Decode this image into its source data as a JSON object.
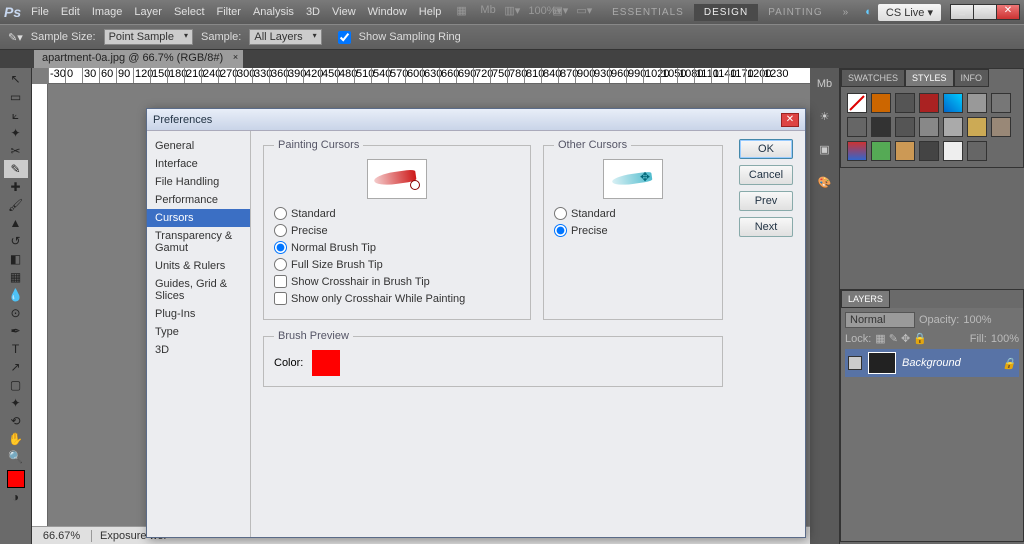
{
  "app": {
    "name": "Ps"
  },
  "menu": [
    "File",
    "Edit",
    "Image",
    "Layer",
    "Select",
    "Filter",
    "Analysis",
    "3D",
    "View",
    "Window",
    "Help"
  ],
  "workspace": {
    "items": [
      "ESSENTIALS",
      "DESIGN",
      "PAINTING"
    ],
    "active": 1,
    "cslive": "CS Live"
  },
  "options": {
    "tool_icon": "eyedropper",
    "sample_size_lbl": "Sample Size:",
    "sample_size": "Point Sample",
    "sample_lbl": "Sample:",
    "sample": "All Layers",
    "show_ring": "Show Sampling Ring",
    "ring_checked": true
  },
  "document": {
    "tab": "apartment-0a.jpg @ 66.7% (RGB/8#)",
    "zoom": "66.67%",
    "status": "Exposure wor"
  },
  "ruler": [
    -30,
    0,
    30,
    60,
    90,
    120,
    150,
    180,
    210,
    240,
    270,
    300,
    330,
    360,
    390,
    420,
    450,
    480,
    510,
    540,
    570,
    600,
    630,
    660,
    690,
    720,
    750,
    780,
    810,
    840,
    870,
    900,
    930,
    960,
    990,
    1020,
    1050,
    1080,
    1110,
    1140,
    1170,
    1200,
    1230
  ],
  "dialog": {
    "title": "Preferences",
    "nav": [
      "General",
      "Interface",
      "File Handling",
      "Performance",
      "Cursors",
      "Transparency & Gamut",
      "Units & Rulers",
      "Guides, Grid & Slices",
      "Plug-Ins",
      "Type",
      "3D"
    ],
    "nav_sel": 4,
    "painting": {
      "legend": "Painting Cursors",
      "standard": "Standard",
      "precise": "Precise",
      "normal": "Normal Brush Tip",
      "full": "Full Size Brush Tip",
      "cross1": "Show Crosshair in Brush Tip",
      "cross2": "Show only Crosshair While Painting"
    },
    "other": {
      "legend": "Other Cursors",
      "standard": "Standard",
      "precise": "Precise"
    },
    "brushprev": {
      "legend": "Brush Preview",
      "color_lbl": "Color:"
    },
    "buttons": {
      "ok": "OK",
      "cancel": "Cancel",
      "prev": "Prev",
      "next": "Next"
    }
  },
  "panels": {
    "swatches_tabs": [
      "SWATCHES",
      "STYLES",
      "INFO"
    ],
    "layers_tab": "LAYERS",
    "blend": "Normal",
    "opacity_lbl": "Opacity:",
    "opacity": "100%",
    "lock_lbl": "Lock:",
    "fill_lbl": "Fill:",
    "fill": "100%",
    "layer_name": "Background"
  }
}
